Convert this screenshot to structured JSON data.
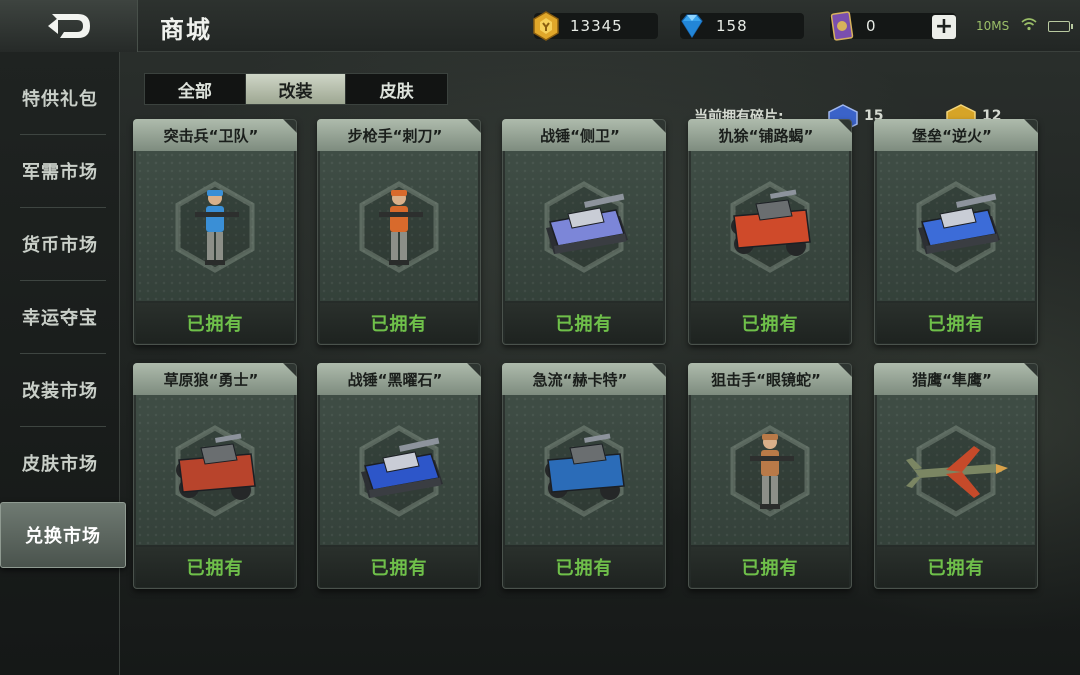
{
  "header": {
    "title": "商城",
    "gold": "13345",
    "diamond": "158",
    "cards": "0",
    "network": "10MS"
  },
  "sidebar": {
    "items": [
      {
        "label": "特供礼包"
      },
      {
        "label": "军需市场"
      },
      {
        "label": "货币市场"
      },
      {
        "label": "幸运夺宝"
      },
      {
        "label": "改装市场"
      },
      {
        "label": "皮肤市场"
      },
      {
        "label": "兑换市场",
        "active": true
      }
    ]
  },
  "tabs": [
    {
      "label": "全部"
    },
    {
      "label": "改装",
      "active": true
    },
    {
      "label": "皮肤"
    }
  ],
  "owned": {
    "label": "当前拥有碎片:",
    "blue": "15",
    "gold": "12"
  },
  "cards": [
    {
      "title": "突击兵“卫队”",
      "status": "已拥有",
      "unit": "soldier",
      "color": "#3a8fd6"
    },
    {
      "title": "步枪手“刺刀”",
      "status": "已拥有",
      "unit": "soldier",
      "color": "#d86a2c"
    },
    {
      "title": "战锤“侧卫”",
      "status": "已拥有",
      "unit": "tank",
      "color": "#7c86d8"
    },
    {
      "title": "犰狳“铺路蝎”",
      "status": "已拥有",
      "unit": "car",
      "color": "#cf4a2a"
    },
    {
      "title": "堡垒“逆火”",
      "status": "已拥有",
      "unit": "tank",
      "color": "#3c6cd8"
    },
    {
      "title": "草原狼“勇士”",
      "status": "已拥有",
      "unit": "car",
      "color": "#b8442c"
    },
    {
      "title": "战锤“黑曜石”",
      "status": "已拥有",
      "unit": "tank",
      "color": "#2d56c9"
    },
    {
      "title": "急流“赫卡特”",
      "status": "已拥有",
      "unit": "car",
      "color": "#2b6cb8"
    },
    {
      "title": "狙击手“眼镜蛇”",
      "status": "已拥有",
      "unit": "soldier",
      "color": "#b97a48"
    },
    {
      "title": "猎鹰“隼鹰”",
      "status": "已拥有",
      "unit": "plane",
      "color": "#c64a2a"
    }
  ]
}
